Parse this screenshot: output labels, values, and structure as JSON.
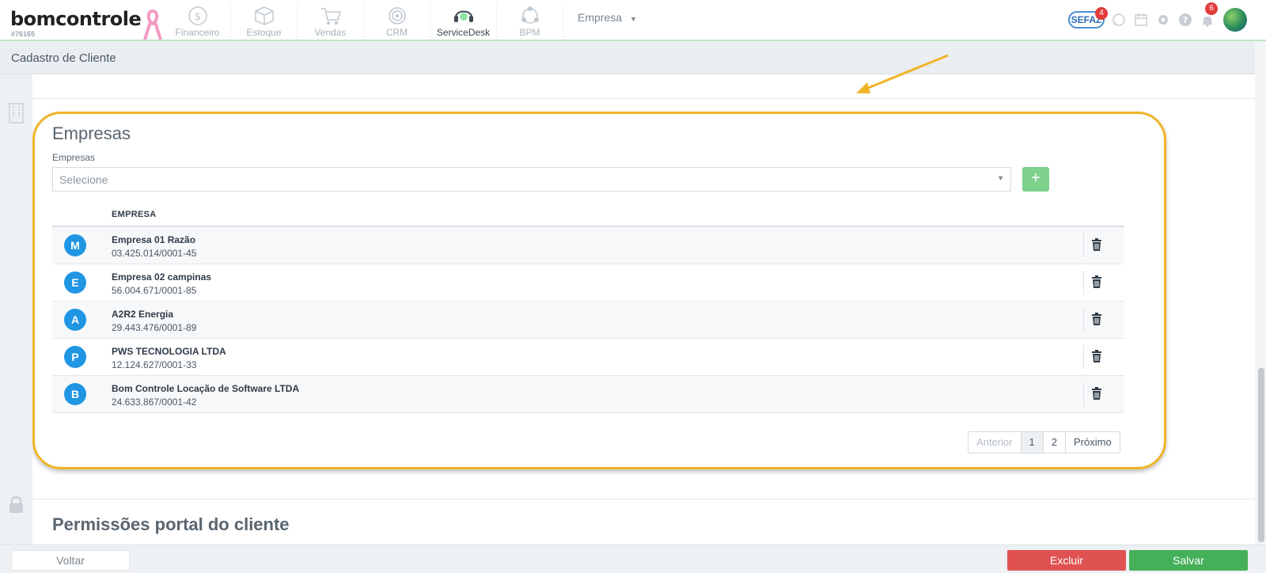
{
  "brand": {
    "logo_text": "bomcontrole",
    "account_id": "#76165"
  },
  "nav": {
    "modules": [
      {
        "label": "Financeiro",
        "icon": "dollar-circle-icon"
      },
      {
        "label": "Estoque",
        "icon": "box-icon"
      },
      {
        "label": "Vendas",
        "icon": "cart-icon"
      },
      {
        "label": "CRM",
        "icon": "target-icon"
      },
      {
        "label": "ServiceDesk",
        "icon": "headset-icon",
        "active": true
      },
      {
        "label": "BPM",
        "icon": "workflow-icon"
      }
    ],
    "company_dropdown": "Empresa",
    "sefaz_label": "SEFAZ",
    "sefaz_badge": "4",
    "notifications_badge": "6"
  },
  "page": {
    "title": "Cadastro de Cliente"
  },
  "empresas_section": {
    "title": "Empresas",
    "field_label": "Empresas",
    "select_placeholder": "Selecione",
    "add_button": "+",
    "column_header": "EMPRESA",
    "rows": [
      {
        "initial": "M",
        "name": "Empresa 01 Razão",
        "cnpj": "03.425.014/0001-45"
      },
      {
        "initial": "E",
        "name": "Empresa 02 campinas",
        "cnpj": "56.004.671/0001-85"
      },
      {
        "initial": "A",
        "name": "A2R2 Energia",
        "cnpj": "29.443.476/0001-89"
      },
      {
        "initial": "P",
        "name": "PWS TECNOLOGIA LTDA",
        "cnpj": "12.124.627/0001-33"
      },
      {
        "initial": "B",
        "name": "Bom Controle Locação de Software LTDA",
        "cnpj": "24.633.867/0001-42"
      }
    ],
    "pagination": {
      "prev": "Anterior",
      "pages": [
        "1",
        "2"
      ],
      "current": "1",
      "next": "Próximo"
    }
  },
  "permissions_section": {
    "title": "Permissões portal do cliente"
  },
  "footer": {
    "back": "Voltar",
    "delete": "Excluir",
    "save": "Salvar"
  },
  "colors": {
    "accent_green": "#45b05a",
    "danger_red": "#e05252",
    "avatar_blue": "#1f95e3",
    "highlight_yellow": "#f0b429"
  }
}
